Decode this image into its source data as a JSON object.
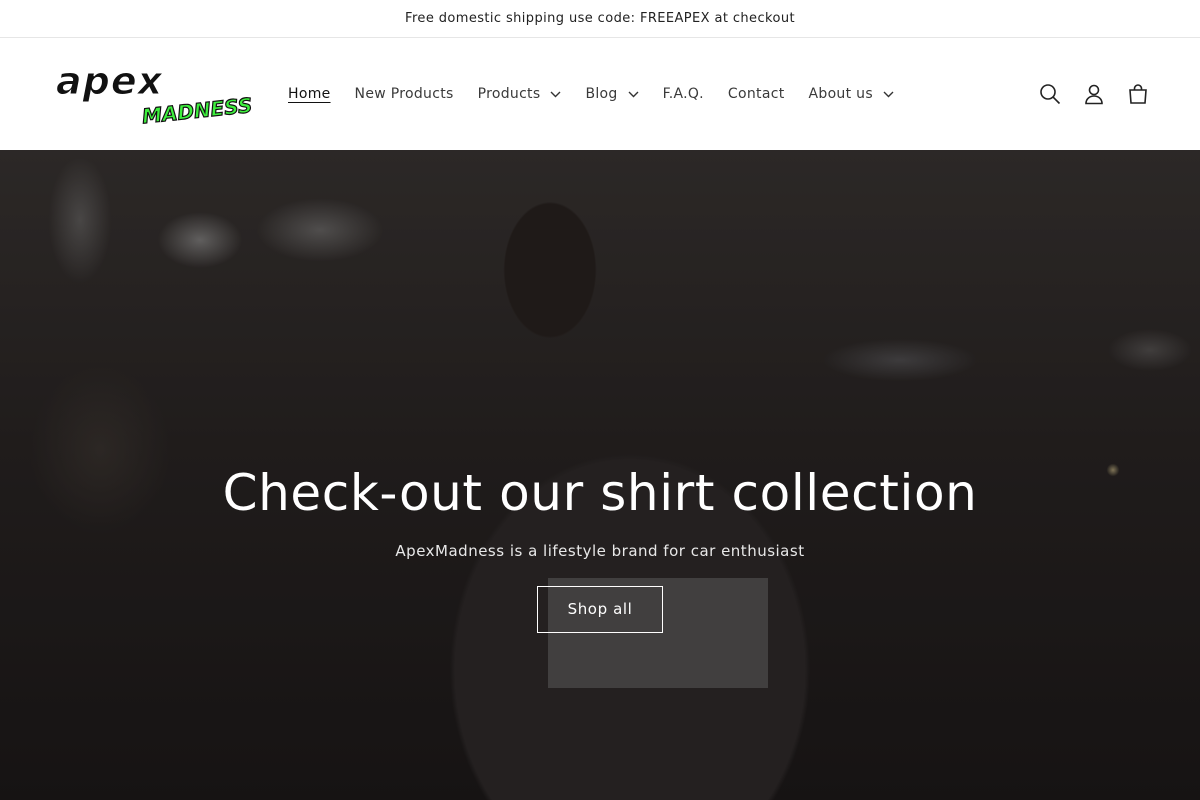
{
  "announcement": {
    "text": "Free domestic shipping use code: FREEAPEX at checkout"
  },
  "logo": {
    "line1": "APEX",
    "line2": "MADNESS",
    "accent": "#3df03d"
  },
  "nav": {
    "items": [
      {
        "label": "Home",
        "active": true,
        "dropdown": false
      },
      {
        "label": "New Products",
        "active": false,
        "dropdown": false
      },
      {
        "label": "Products",
        "active": false,
        "dropdown": true
      },
      {
        "label": "Blog",
        "active": false,
        "dropdown": true
      },
      {
        "label": "F.A.Q.",
        "active": false,
        "dropdown": false
      },
      {
        "label": "Contact",
        "active": false,
        "dropdown": false
      },
      {
        "label": "About us",
        "active": false,
        "dropdown": true
      }
    ]
  },
  "header_icons": [
    "search-icon",
    "account-icon",
    "cart-icon"
  ],
  "hero": {
    "title": "Check-out our shirt collection",
    "subtitle": "ApexMadness is a lifestyle brand for car enthusiast",
    "button_label": "Shop all"
  }
}
